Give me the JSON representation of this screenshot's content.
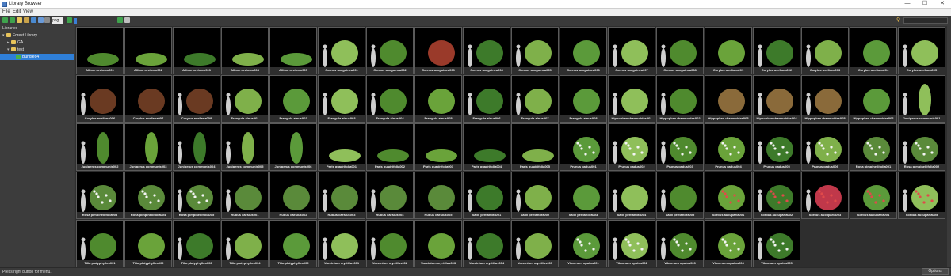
{
  "window": {
    "title": "Library Browser",
    "minimize": "—",
    "maximize": "☐",
    "close": "✕"
  },
  "menu": [
    "File",
    "Edit",
    "View"
  ],
  "toolbar": {
    "format": "png"
  },
  "sidebar": {
    "label": "Libraries",
    "items": [
      {
        "label": "Forest Library",
        "depth": 0,
        "expanded": true
      },
      {
        "label": "GA",
        "depth": 1,
        "expanded": false
      },
      {
        "label": "test",
        "depth": 1,
        "expanded": true
      },
      {
        "label": "Bundled4",
        "depth": 2,
        "selected": true
      }
    ]
  },
  "tiles": [
    "Allium ursinum001",
    "Allium ursinum002",
    "Allium ursinum003",
    "Allium ursinum004",
    "Allium ursinum005",
    "Cornus sanguinea001",
    "Cornus sanguinea002",
    "Cornus sanguinea003",
    "Cornus sanguinea004",
    "Cornus sanguinea005",
    "Cornus sanguinea006",
    "Cornus sanguinea007",
    "Cornus sanguinea008",
    "Corylus avellana001",
    "Corylus avellana002",
    "Corylus avellana003",
    "Corylus avellana004",
    "Corylus avellana005",
    "Corylus avellana006",
    "Corylus avellana007",
    "Corylus avellana008",
    "Frangula alnus001",
    "Frangula alnus002",
    "Frangula alnus003",
    "Frangula alnus004",
    "Frangula alnus005",
    "Frangula alnus006",
    "Frangula alnus007",
    "Frangula alnus008",
    "Hippophae rhamnoides001",
    "Hippophae rhamnoides002",
    "Hippophae rhamnoides003",
    "Hippophae rhamnoides004",
    "Hippophae rhamnoides005",
    "Hippophae rhamnoides006",
    "Juniperus communis001",
    "Juniperus communis002",
    "Juniperus communis003",
    "Juniperus communis004",
    "Juniperus communis005",
    "Juniperus communis006",
    "Paris quadrifolia001",
    "Paris quadrifolia002",
    "Paris quadrifolia003",
    "Paris quadrifolia004",
    "Paris quadrifolia005",
    "Prunus padus001",
    "Prunus padus002",
    "Prunus padus003",
    "Prunus padus004",
    "Prunus padus005",
    "Prunus padus006",
    "Rosa pimpinellifolia001",
    "Rosa pimpinellifolia002",
    "Rosa pimpinellifolia003",
    "Rosa pimpinellifolia004",
    "Rosa pimpinellifolia005",
    "Rubus caesius001",
    "Rubus caesius002",
    "Rubus caesius003",
    "Rubus caesius004",
    "Rubus caesius005",
    "Salix pentandra001",
    "Salix pentandra002",
    "Salix pentandra003",
    "Salix pentandra004",
    "Salix pentandra005",
    "Sorbus aucuparia001",
    "Sorbus aucuparia002",
    "Sorbus aucuparia003",
    "Sorbus aucuparia004",
    "Sorbus aucuparia005",
    "Tilia platyphyllos001",
    "Tilia platyphyllos002",
    "Tilia platyphyllos003",
    "Tilia platyphyllos004",
    "Tilia platyphyllos005",
    "Vaccinium myrtillus001",
    "Vaccinium myrtillus002",
    "Vaccinium myrtillus003",
    "Vaccinium myrtillus004",
    "Vaccinium myrtillus005",
    "Viburnum opulus001",
    "Viburnum opulus002",
    "Viburnum opulus003",
    "Viburnum opulus004",
    "Viburnum opulus005"
  ],
  "status": "Press right button for menu.",
  "options_label": "Options",
  "colors": {
    "accent": "#2f7fd8",
    "folder": "#e7c35a"
  }
}
